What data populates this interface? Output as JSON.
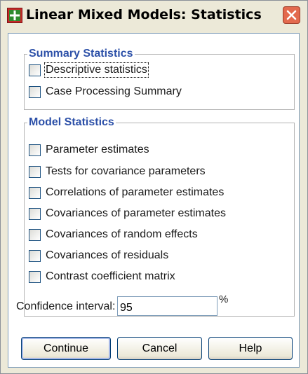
{
  "window": {
    "title": "Linear Mixed Models: Statistics",
    "icon": "spss-dialog-icon",
    "close_icon": "close-icon"
  },
  "summary": {
    "title": "Summary Statistics",
    "items": [
      {
        "label": "Descriptive statistics",
        "checked": false,
        "focused": true
      },
      {
        "label": "Case Processing Summary",
        "checked": false
      }
    ]
  },
  "model": {
    "title": "Model Statistics",
    "items": [
      {
        "label": "Parameter estimates",
        "checked": false
      },
      {
        "label": "Tests for covariance parameters",
        "checked": false
      },
      {
        "label": "Correlations of parameter estimates",
        "checked": false
      },
      {
        "label": "Covariances of parameter estimates",
        "checked": false
      },
      {
        "label": "Covariances of random effects",
        "checked": false
      },
      {
        "label": "Covariances of residuals",
        "checked": false
      },
      {
        "label": "Contrast coefficient matrix",
        "checked": false
      }
    ]
  },
  "confidence": {
    "label": "Confidence interval:",
    "value": "95",
    "unit": "%"
  },
  "buttons": {
    "continue": "Continue",
    "cancel": "Cancel",
    "help": "Help"
  },
  "colors": {
    "group_title": "#2c50a8",
    "dialog_bg": "#ece9d8",
    "close_red": "#e36a4e"
  }
}
